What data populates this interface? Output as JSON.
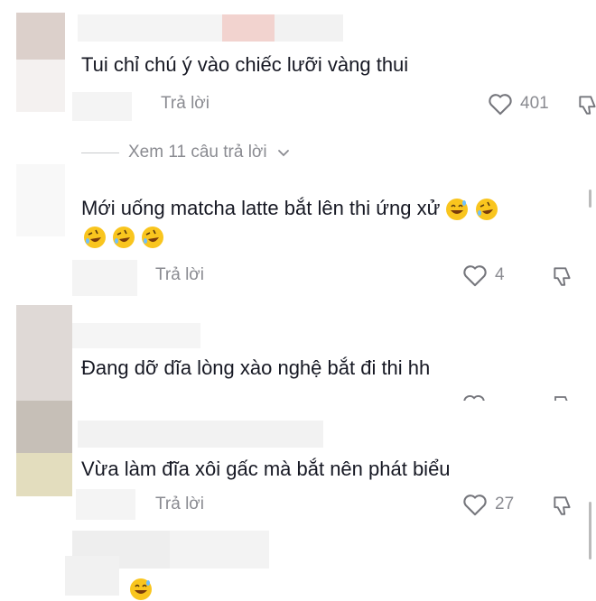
{
  "comments": [
    {
      "text": "Tui chỉ chú ý vào chiếc lưỡi vàng thui",
      "reply_label": "Trả lời",
      "likes": "401"
    },
    {
      "text": "Mới uống matcha latte bắt lên thi ứng xử",
      "reply_label": "Trả lời",
      "likes": "4"
    },
    {
      "text": "Đang dỡ dĩa lòng xào nghệ bắt đi thi hh"
    },
    {
      "text": "Vừa làm đĩa xôi gấc mà bắt nên phát biểu",
      "reply_label": "Trả lời",
      "likes": "27"
    }
  ],
  "view_replies": "Xem 11 câu trả lời",
  "icons": {
    "like": "heart-outline-icon",
    "dislike": "thumbs-down-icon",
    "chevron": "chevron-down-icon",
    "emoji_laugh": "rolling-laughing-emoji",
    "emoji_sweat": "grinning-sweat-emoji"
  },
  "colors": {
    "text": "#161823",
    "muted": "#8a8b91",
    "emoji": "#f9c51e"
  }
}
